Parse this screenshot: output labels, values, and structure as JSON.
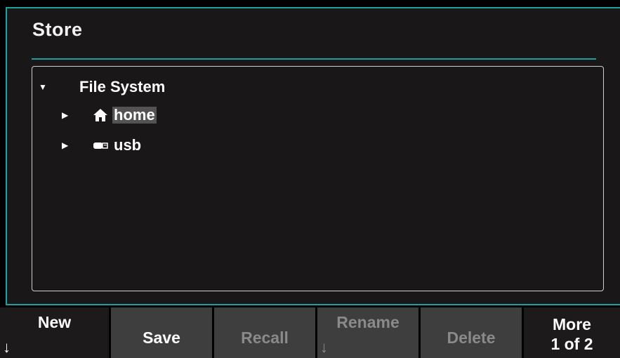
{
  "dialog": {
    "title": "Store"
  },
  "tree": {
    "root": {
      "label": "File System",
      "expanded": true
    },
    "items": [
      {
        "label": "home",
        "icon": "home-icon",
        "selected": true,
        "expanded": false
      },
      {
        "label": "usb",
        "icon": "usb-drive-icon",
        "selected": false,
        "expanded": false
      }
    ]
  },
  "softkeys": [
    {
      "label": "New",
      "arrow": "↓",
      "enabled": true
    },
    {
      "label": "Save",
      "enabled": true
    },
    {
      "label": "Recall",
      "enabled": false
    },
    {
      "label": "Rename",
      "arrow": "↓",
      "enabled": false
    },
    {
      "label": "Delete",
      "enabled": false
    },
    {
      "label": "More",
      "sub": "1 of 2",
      "enabled": true
    }
  ],
  "colors": {
    "accent": "#1fa0a0",
    "selection": "#535353",
    "panel": "#1a1718",
    "key_gray": "#3e3e3e"
  }
}
